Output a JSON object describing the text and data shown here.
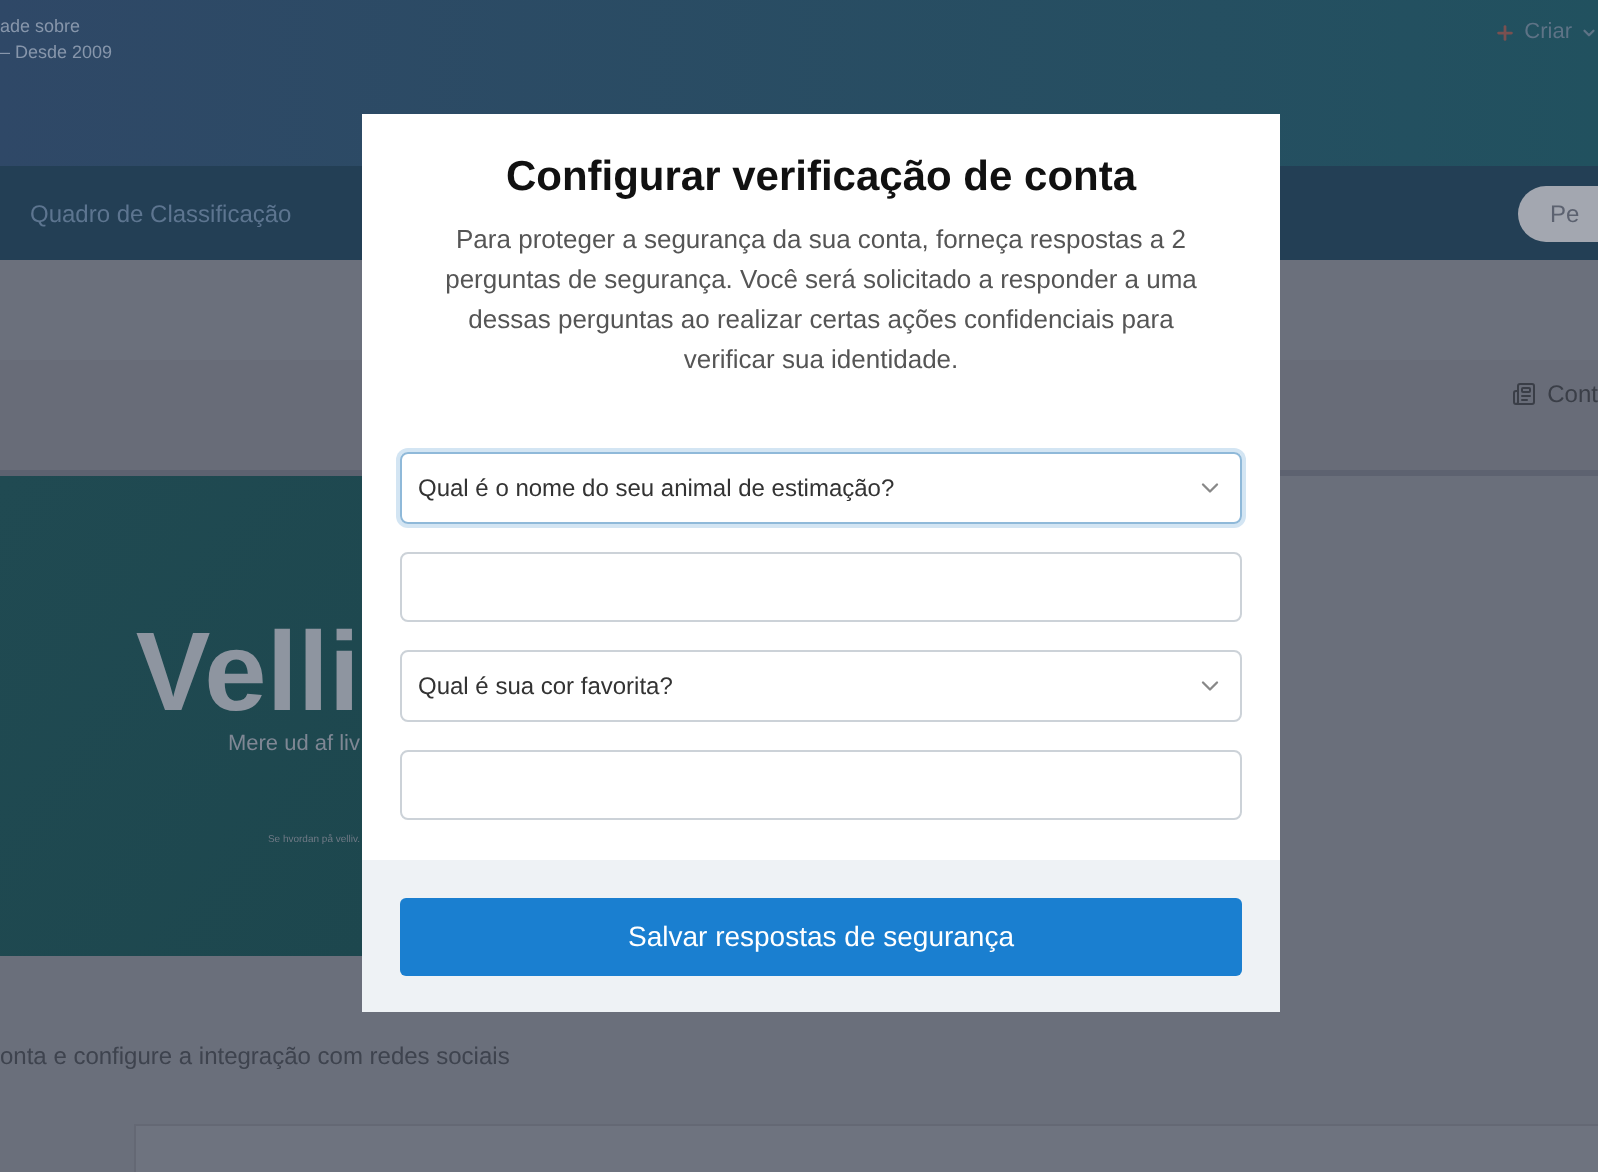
{
  "header": {
    "tagline_lines": [
      "ade sobre",
      "– Desde 2009"
    ],
    "create_menu": "Criar"
  },
  "nav": {
    "items": [
      "Quadro de Classificação"
    ],
    "pill": "Pe"
  },
  "toolbar": {
    "link": "Cont"
  },
  "banner": {
    "logo": "Velli",
    "slogan": "Mere ud af liv",
    "footnote": "Se hvordan på velliv."
  },
  "page_subtitle": "onta e configure a integração com redes sociais",
  "dialog": {
    "title": "Configurar verificação de conta",
    "description": "Para proteger a segurança da sua conta, forneça respostas a 2 perguntas de segurança. Você será solicitado a responder a uma dessas perguntas ao realizar certas ações confidenciais para verificar sua identidade.",
    "questions": [
      {
        "question": "Qual é o nome do seu animal de estimação?",
        "focused": true
      },
      {
        "question": "Qual é sua cor favorita?",
        "focused": false
      }
    ],
    "submit": "Salvar respostas de segurança"
  }
}
